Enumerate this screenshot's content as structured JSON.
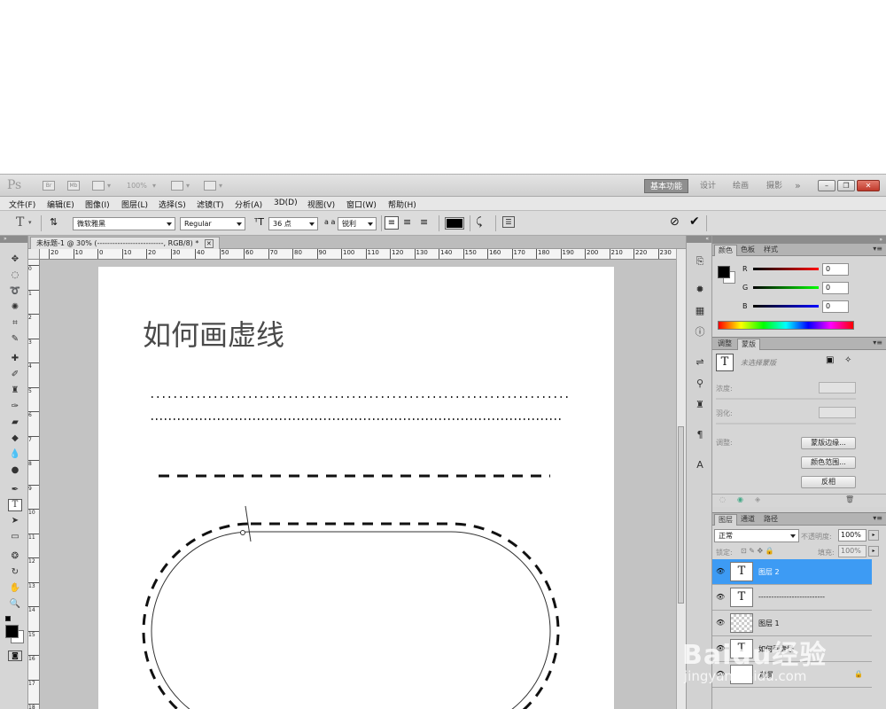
{
  "titlebar": {
    "app_logo": "Ps",
    "zoom": "100%",
    "workspaces": [
      "基本功能",
      "设计",
      "绘画",
      "摄影"
    ],
    "more": "»"
  },
  "menu": [
    "文件(F)",
    "编辑(E)",
    "图像(I)",
    "图层(L)",
    "选择(S)",
    "滤镜(T)",
    "分析(A)",
    "3D(D)",
    "视图(V)",
    "窗口(W)",
    "帮助(H)"
  ],
  "options": {
    "tool_icon": "T",
    "font_family": "微软雅黑",
    "font_style": "Regular",
    "font_size": "36 点",
    "aa_label": "a a",
    "anti_alias": "锐利",
    "text_color": "#000000"
  },
  "document": {
    "tab_title": "未标题-1 @ 30% (--------------------------, RGB/8) *",
    "heading": "如何画虚线",
    "ruler_h": [
      "20",
      "10",
      "0",
      "10",
      "20",
      "30",
      "40",
      "50",
      "60",
      "70",
      "80",
      "90",
      "100",
      "110",
      "120",
      "130",
      "140",
      "150",
      "160",
      "170",
      "180",
      "190",
      "200",
      "210",
      "220",
      "230"
    ],
    "ruler_v": [
      "0",
      "1",
      "2",
      "3",
      "4",
      "5",
      "6",
      "7",
      "8",
      "9",
      "10",
      "11",
      "12",
      "13",
      "14",
      "15",
      "16",
      "17",
      "18"
    ]
  },
  "color_panel": {
    "tabs": [
      "颜色",
      "色板",
      "样式"
    ],
    "r_label": "R",
    "g_label": "G",
    "b_label": "B",
    "r_value": "0",
    "g_value": "0",
    "b_value": "0",
    "foreground": "#000000",
    "background": "#ffffff"
  },
  "masks_panel": {
    "tabs": [
      "调整",
      "蒙版"
    ],
    "status": "未选择蒙版",
    "density_label": "浓度:",
    "feather_label": "羽化:",
    "refine_label": "调整:",
    "btn_edge": "蒙版边缘...",
    "btn_range": "颜色范围...",
    "btn_invert": "反相"
  },
  "layers_panel": {
    "tabs": [
      "图层",
      "通道",
      "路径"
    ],
    "blend_mode": "正常",
    "opacity_label": "不透明度:",
    "opacity": "100%",
    "lock_label": "锁定:",
    "fill_label": "填充:",
    "fill": "100%",
    "layers": [
      {
        "name": "图层 2",
        "thumb": "T",
        "selected": true
      },
      {
        "name": "--------------------------",
        "thumb": "T",
        "selected": false
      },
      {
        "name": "图层 1",
        "thumb": "",
        "selected": false
      },
      {
        "name": "如何画虚线",
        "thumb": "T",
        "selected": false
      },
      {
        "name": "背景",
        "thumb": "",
        "selected": false
      }
    ]
  },
  "watermark": {
    "text": "Baidu经验",
    "url": "jingyan.baidu.com"
  }
}
